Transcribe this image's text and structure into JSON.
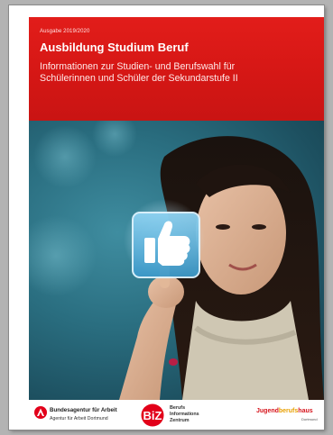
{
  "cover": {
    "edition": "Ausgabe 2019/2020",
    "title": "Ausbildung Studium Beruf",
    "subtitle_line1": "Informationen zur Studien- und Berufswahl für",
    "subtitle_line2": "Schülerinnen und Schüler der Sekundarstufe II"
  },
  "photo": {
    "description_icon": "thumbs-up-icon"
  },
  "footer": {
    "ba_name": "Bundesagentur für Arbeit",
    "ba_sub": "Agentur für Arbeit Dortmund",
    "biz_mark": "BiZ",
    "biz_line1": "Berufs",
    "biz_line2": "Informations",
    "biz_line3": "Zentrum",
    "jbh_part1": "Jugend",
    "jbh_part2": "berufs",
    "jbh_part3": "haus",
    "jbh_sub": "Dortmund"
  },
  "colors": {
    "header_red": "#d51715",
    "viewer_gray": "#b3b3b3",
    "photo_teal": "#2a6e80"
  }
}
